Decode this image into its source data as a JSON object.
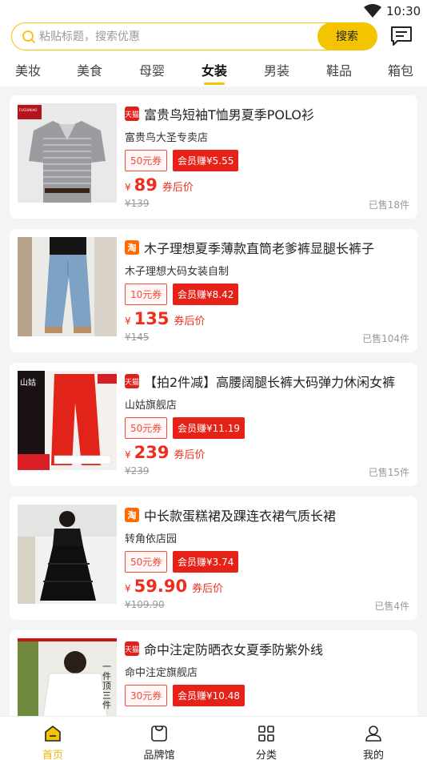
{
  "status_bar": {
    "time": "10:30"
  },
  "search": {
    "placeholder": "粘贴标题，搜索优惠",
    "button_label": "搜索"
  },
  "tabs": [
    {
      "label": "美妆"
    },
    {
      "label": "美食"
    },
    {
      "label": "母婴"
    },
    {
      "label": "女装",
      "active": true
    },
    {
      "label": "男装"
    },
    {
      "label": "鞋品"
    },
    {
      "label": "箱包"
    }
  ],
  "products": [
    {
      "platform": "天猫",
      "title": "富贵鸟短袖T恤男夏季POLO衫",
      "shop": "富贵鸟大圣专卖店",
      "coupon": "50元券",
      "vip": "会员赚¥5.55",
      "currency": "¥",
      "price": "89",
      "price_tag": "券后价",
      "orig": "¥139",
      "sold": "已售18件",
      "thumb_text": "FUGUINIAO"
    },
    {
      "platform": "淘",
      "title": "木子理想夏季薄款直筒老爹裤显腿长裤子",
      "shop": "木子理想大码女装自制",
      "coupon": "10元券",
      "vip": "会员赚¥8.42",
      "currency": "¥",
      "price": "135",
      "price_tag": "券后价",
      "orig": "¥145",
      "sold": "已售104件",
      "thumb_text": ""
    },
    {
      "platform": "天猫",
      "title": "【拍2件减】高腰阔腿长裤大码弹力休闲女裤",
      "shop": "山姑旗舰店",
      "coupon": "50元券",
      "vip": "会员赚¥11.19",
      "currency": "¥",
      "price": "239",
      "price_tag": "券后价",
      "orig": "¥239",
      "sold": "已售15件",
      "thumb_text": "山姑"
    },
    {
      "platform": "淘",
      "title": "中长款蛋糕裙及踝连衣裙气质长裙",
      "shop": "转角依店园",
      "coupon": "50元券",
      "vip": "会员赚¥3.74",
      "currency": "¥",
      "price": "59.90",
      "price_tag": "券后价",
      "orig": "¥109.90",
      "sold": "已售4件",
      "thumb_text": ""
    },
    {
      "platform": "天猫",
      "title": "命中注定防晒衣女夏季防紫外线",
      "shop": "命中注定旗舰店",
      "coupon": "30元券",
      "vip": "会员赚¥10.48",
      "currency": "¥",
      "price": "",
      "price_tag": "",
      "orig": "",
      "sold": "",
      "thumb_text": "一件顶三件"
    }
  ],
  "bottom_nav": [
    {
      "label": "首页",
      "icon": "home-icon",
      "active": true
    },
    {
      "label": "品牌馆",
      "icon": "bag-icon"
    },
    {
      "label": "分类",
      "icon": "grid-icon"
    },
    {
      "label": "我的",
      "icon": "user-icon"
    }
  ],
  "colors": {
    "accent": "#f5c400",
    "price": "#ef2d1e",
    "tmall": "#e0201c",
    "taobao": "#ff6a00"
  }
}
